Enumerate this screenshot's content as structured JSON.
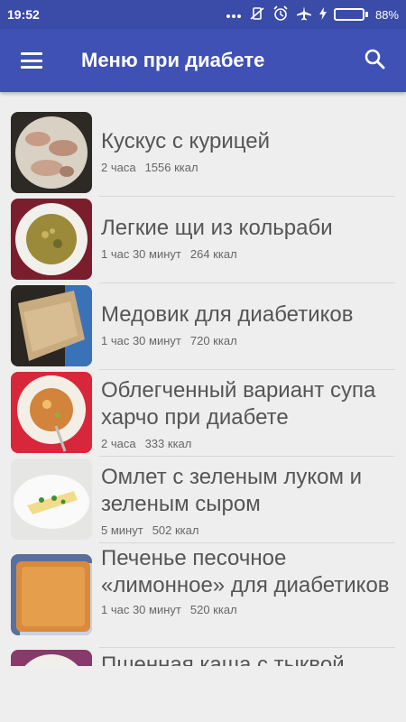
{
  "status_bar": {
    "time": "19:52",
    "battery_percent": "88%",
    "battery_level": 0.88
  },
  "app_bar": {
    "title": "Меню при диабете",
    "menu_icon": "hamburger-menu-icon",
    "search_icon": "search-icon"
  },
  "recipes": [
    {
      "title": "Кускус с курицей",
      "time": "2 часа",
      "calories": "1556 ккал"
    },
    {
      "title": "Легкие щи из кольраби",
      "time": "1 час 30 минут",
      "calories": "264 ккал"
    },
    {
      "title": "Медовик для диабетиков",
      "time": "1 час 30 минут",
      "calories": "720 ккал"
    },
    {
      "title": "Облегченный вариант супа харчо при диабете",
      "time": "2 часа",
      "calories": "333 ккал"
    },
    {
      "title": "Омлет с зеленым луком и зеленым сыром",
      "time": "5 минут",
      "calories": "502 ккал"
    },
    {
      "title": "Печенье песочное «лимонное» для диабетиков",
      "time": "1 час 30 минут",
      "calories": "520 ккал"
    },
    {
      "title": "Пшенная каша с тыквой"
    }
  ],
  "colors": {
    "app_bar": "#3f51b5",
    "status_bar": "#3a4ba8",
    "background": "#eeeeee"
  }
}
